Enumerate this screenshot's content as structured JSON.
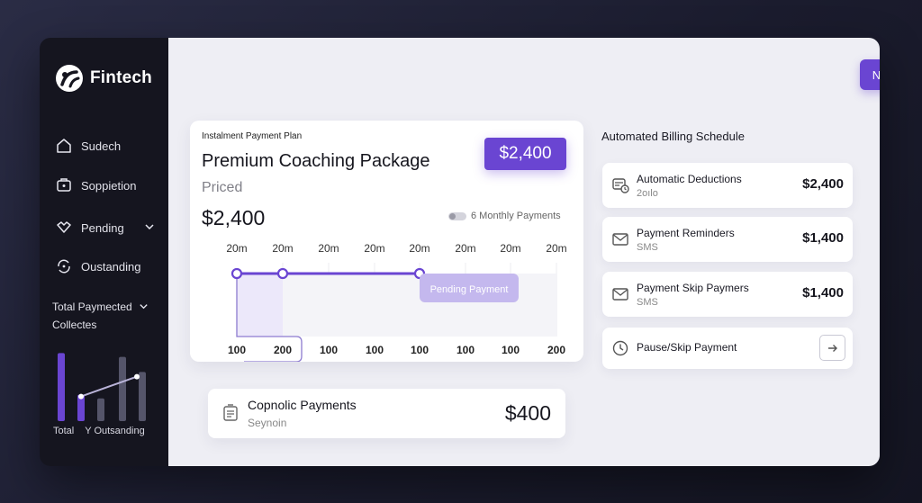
{
  "brand": {
    "name": "Fintech",
    "logo_icon": "fintech-logo-icon"
  },
  "sidebar": {
    "items": [
      {
        "label": "Sudech",
        "icon": "home-icon"
      },
      {
        "label": "Soppietion",
        "icon": "wallet-icon"
      },
      {
        "label": "Pending",
        "icon": "handshake-icon",
        "has_chevron": true
      },
      {
        "label": "Oustanding",
        "icon": "refresh-icon"
      }
    ],
    "total_block": {
      "line1": "Total Paymected",
      "line2": "Collectes"
    },
    "mini_legend": {
      "total": "Total",
      "outstanding": "Outsanding",
      "separator": "Y"
    },
    "mini_chart_values": [
      0.9,
      0.35,
      0.3,
      0.85,
      0.65
    ]
  },
  "header": {
    "new_plan_button": "New Payment Plan"
  },
  "plan": {
    "kicker": "Instalment Payment Plan",
    "title": "Premium Coaching Package",
    "priced_label": "Priced",
    "amount": "$2,400",
    "price_badge": "$2,400",
    "monthly_label": "6 Monthly Payments",
    "timeline_top_labels": [
      "20m",
      "20m",
      "20m",
      "20m",
      "20m",
      "20m",
      "20m",
      "20m"
    ],
    "timeline_bottom_labels": [
      "100",
      "200",
      "100",
      "100",
      "100",
      "100",
      "100",
      "200"
    ],
    "pending_label": "Pending Payment"
  },
  "coupon": {
    "title": "Copnolic Payments",
    "subtitle": "Seynoin",
    "amount": "$400"
  },
  "schedule": {
    "title": "Automated Billing Schedule",
    "items": [
      {
        "title": "Automatic Deductions",
        "subtitle": "2oılo",
        "amount": "$2,400",
        "icon": "autopay-icon"
      },
      {
        "title": "Payment Reminders",
        "subtitle": "SMS",
        "amount": "$1,400",
        "icon": "mail-icon"
      },
      {
        "title": "Payment Skip Paymers",
        "subtitle": "SMS",
        "amount": "$1,400",
        "icon": "mail-icon"
      },
      {
        "title": "Pause/Skip Payment",
        "subtitle": "",
        "amount": "",
        "icon": "clock-icon"
      }
    ]
  },
  "colors": {
    "accent": "#6a45d2",
    "sidebar_bg": "#15151f",
    "main_bg": "#eeeef4"
  }
}
